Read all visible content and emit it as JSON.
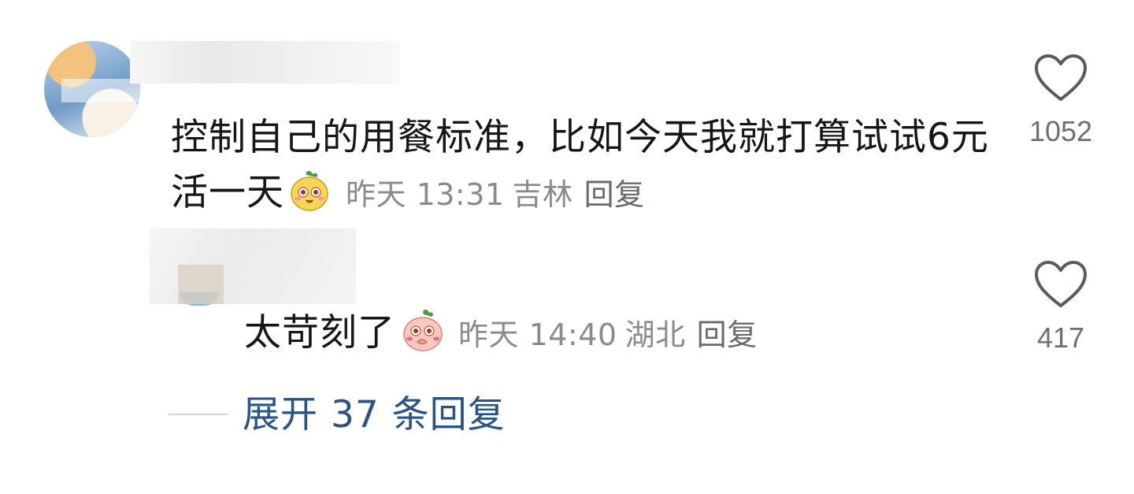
{
  "comment": {
    "text": "控制自己的用餐标准，比如今天我就打算试试6元活一天",
    "time": "昨天 13:31",
    "location": "吉林",
    "reply_label": "回复",
    "likes": "1052",
    "emoji": "mango-smile-emoji"
  },
  "reply": {
    "text": "太苛刻了",
    "time": "昨天 14:40",
    "location": "湖北",
    "reply_label": "回复",
    "likes": "417",
    "emoji": "peach-shy-emoji"
  },
  "expand": {
    "label": "展开 37 条回复"
  },
  "colors": {
    "link": "#2a5485",
    "meta": "#8b8b8b",
    "text": "#161616"
  }
}
